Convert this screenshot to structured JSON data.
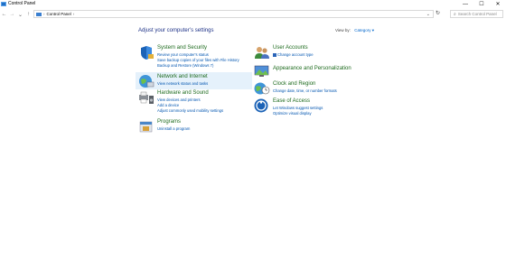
{
  "window": {
    "title": "Control Panel",
    "controls": [
      "—",
      "☐",
      "✕"
    ]
  },
  "address": {
    "back": "←",
    "forward": "→",
    "down": "⌄",
    "up": "↑",
    "breadcrumb": "Control Panel",
    "sep": "›",
    "dropdown": "⌄",
    "refresh": "↻",
    "search_placeholder": "Search Control Panel",
    "search_icon": "⌕"
  },
  "heading": "Adjust your computer’s settings",
  "view_by": {
    "label": "View by:",
    "value": "Category ▾"
  },
  "categories": {
    "system": {
      "name": "System and Security",
      "links": [
        "Review your computer's status",
        "Save backup copies of your files with File History",
        "Backup and Restore (Windows 7)"
      ]
    },
    "network": {
      "name": "Network and Internet",
      "links": [
        "View network status and tasks"
      ]
    },
    "hardware": {
      "name": "Hardware and Sound",
      "links": [
        "View devices and printers",
        "Add a device",
        "Adjust commonly used mobility settings"
      ]
    },
    "programs": {
      "name": "Programs",
      "links": [
        "Uninstall a program"
      ]
    },
    "users": {
      "name": "User Accounts",
      "links": [
        "Change account type"
      ]
    },
    "appearance": {
      "name": "Appearance and Personalization",
      "links": []
    },
    "clock": {
      "name": "Clock and Region",
      "links": [
        "Change date, time, or number formats"
      ]
    },
    "ease": {
      "name": "Ease of Access",
      "links": [
        "Let Windows suggest settings",
        "Optimize visual display"
      ]
    }
  }
}
